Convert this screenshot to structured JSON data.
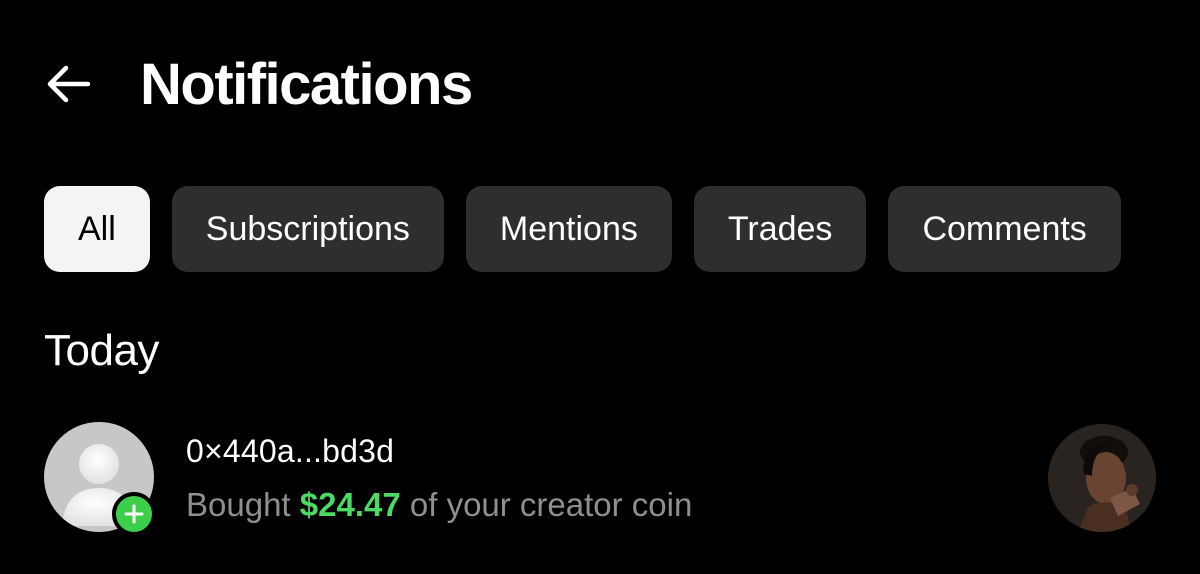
{
  "header": {
    "back_icon": "arrow-left-icon",
    "title": "Notifications"
  },
  "tabs": [
    {
      "label": "All",
      "active": true
    },
    {
      "label": "Subscriptions",
      "active": false
    },
    {
      "label": "Mentions",
      "active": false
    },
    {
      "label": "Trades",
      "active": false
    },
    {
      "label": "Comments",
      "active": false
    }
  ],
  "sections": [
    {
      "title": "Today",
      "items": [
        {
          "user": "0×440a...bd3d",
          "desc_prefix": "Bought",
          "amount": "$24.47",
          "desc_suffix": "of your creator coin",
          "avatar_icon": "default-user-icon",
          "badge_icon": "plus-icon",
          "thumbnail": "creator-photo"
        }
      ]
    }
  ],
  "colors": {
    "background": "#000000",
    "tab_bg": "#2e2e2e",
    "tab_active_bg": "#f4f4f4",
    "accent_green": "#4cd964",
    "secondary_text": "#8e8e93"
  }
}
